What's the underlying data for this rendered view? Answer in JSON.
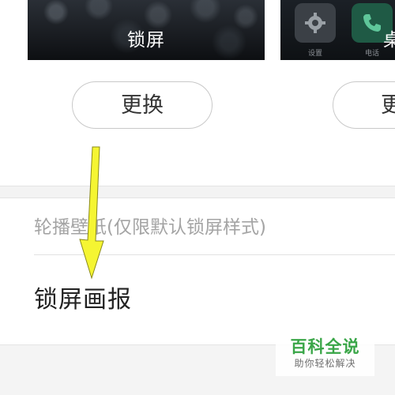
{
  "previews": {
    "lock": {
      "label": "锁屏"
    },
    "home": {
      "label": "桌",
      "apps": [
        {
          "caption": "设置",
          "icon": "gear-icon"
        },
        {
          "caption": "电话",
          "icon": "phone-icon"
        }
      ]
    }
  },
  "buttons": {
    "change_lock": "更换",
    "change_home": "更"
  },
  "settings": {
    "carousel_label": "轮播壁纸(仅限默认锁屏样式)",
    "magazine_label": "锁屏画报"
  },
  "watermark": {
    "title": "百科全说",
    "subtitle": "助你轻松解决"
  },
  "colors": {
    "arrow": "#f5f532",
    "watermark_green": "#3aa648"
  }
}
